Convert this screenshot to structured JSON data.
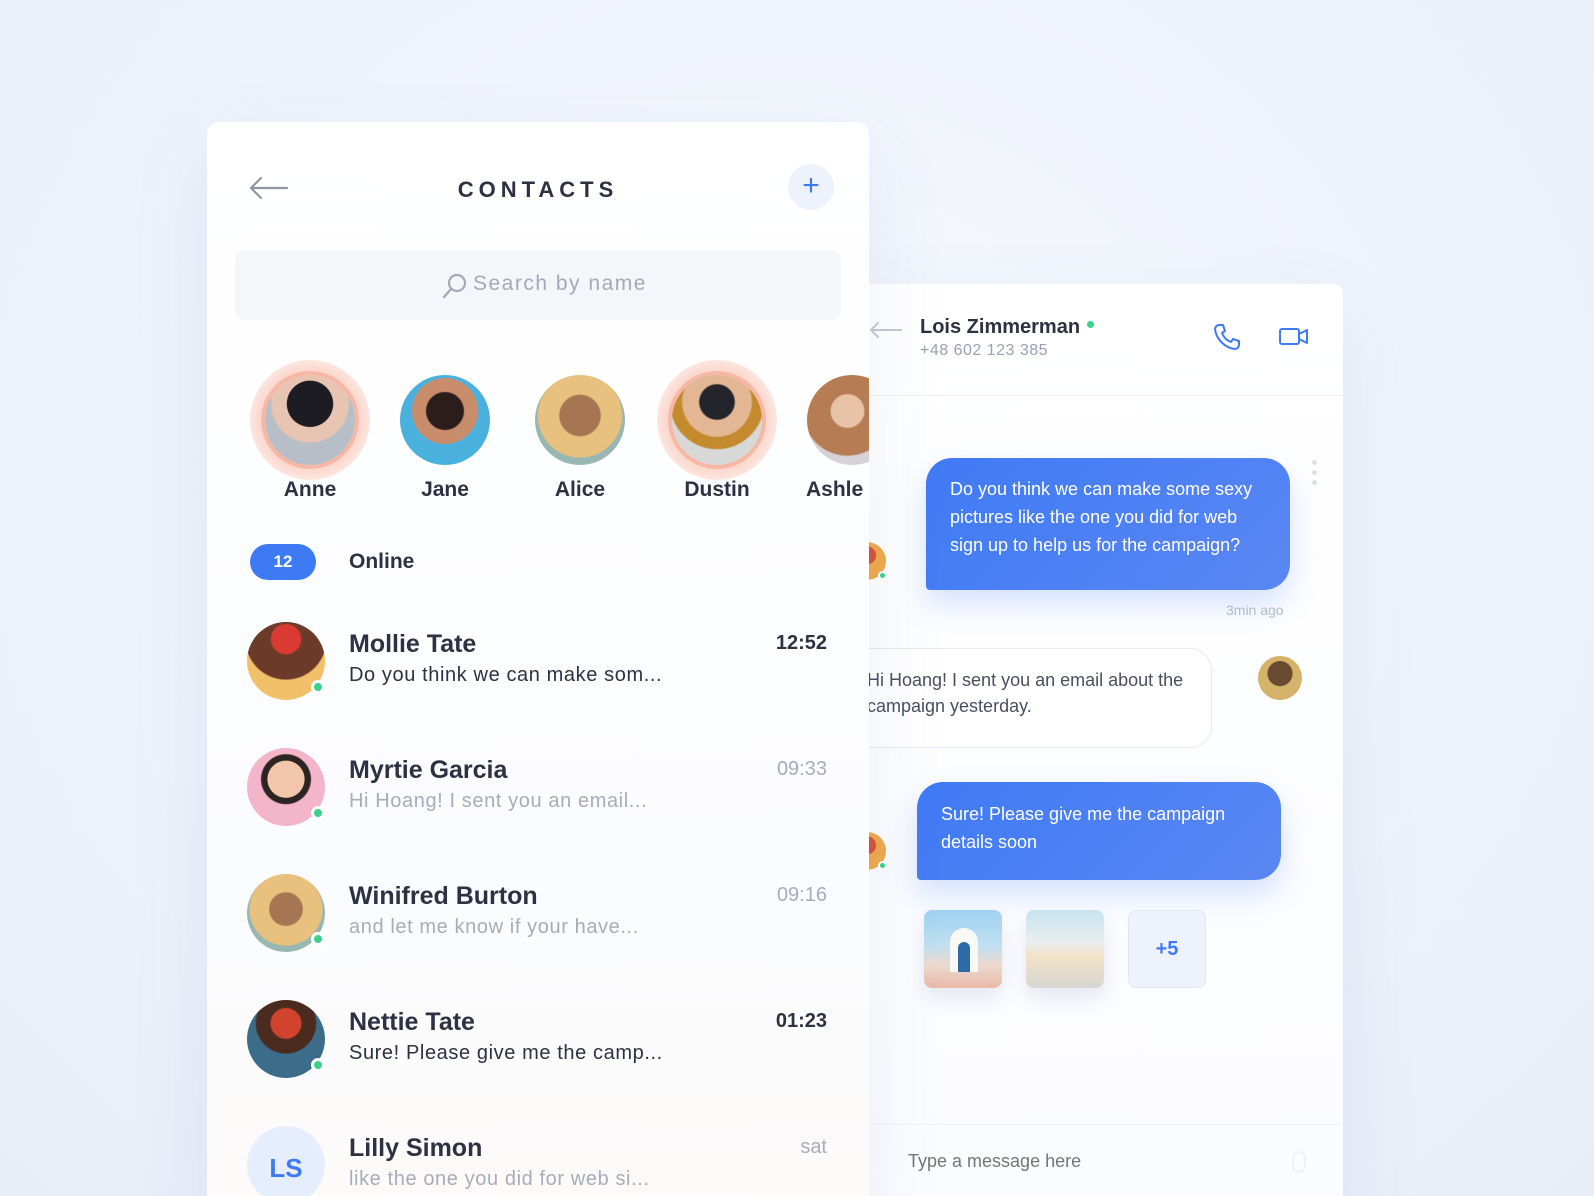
{
  "contacts": {
    "title": "CONTACTS",
    "add_label": "+",
    "search_placeholder": "Search by name",
    "stories": [
      {
        "name": "Anne",
        "active": true
      },
      {
        "name": "Jane",
        "active": false
      },
      {
        "name": "Alice",
        "active": false
      },
      {
        "name": "Dustin",
        "active": true
      },
      {
        "name": "Ashle",
        "active": false
      }
    ],
    "online_count": "12",
    "online_label": "Online",
    "list": [
      {
        "name": "Mollie Tate",
        "message": "Do you think we can make som...",
        "time": "12:52",
        "unread": true,
        "online": true
      },
      {
        "name": "Myrtie Garcia",
        "message": "Hi Hoang! I sent you an email...",
        "time": "09:33",
        "unread": false,
        "online": true
      },
      {
        "name": "Winifred Burton",
        "message": "and let me know if your have...",
        "time": "09:16",
        "unread": false,
        "online": true
      },
      {
        "name": "Nettie Tate",
        "message": "Sure! Please give me the camp...",
        "time": "01:23",
        "unread": true,
        "online": true
      },
      {
        "name": "Lilly Simon",
        "initials": "LS",
        "message": "like the one you did for web si...",
        "time": "sat",
        "unread": false,
        "online": false
      }
    ]
  },
  "chat": {
    "contact_name": "Lois Zimmerman",
    "contact_phone": "+48 602 123 385",
    "messages": [
      {
        "direction": "out",
        "text": "Do you think we can make some sexy pictures like the one you did for web sign up to help us for the campaign?",
        "time": "3min ago"
      },
      {
        "direction": "in",
        "text": "Hi Hoang! I sent you an email about the campaign yesterday."
      },
      {
        "direction": "out",
        "text": "Sure! Please give me the campaign details soon"
      }
    ],
    "attachments_more": "+5",
    "composer_placeholder": "Type a message here"
  },
  "colors": {
    "accent": "#3f7af5",
    "online": "#3ad28a",
    "text_dark": "#2d3142",
    "text_muted": "#a7acba"
  }
}
